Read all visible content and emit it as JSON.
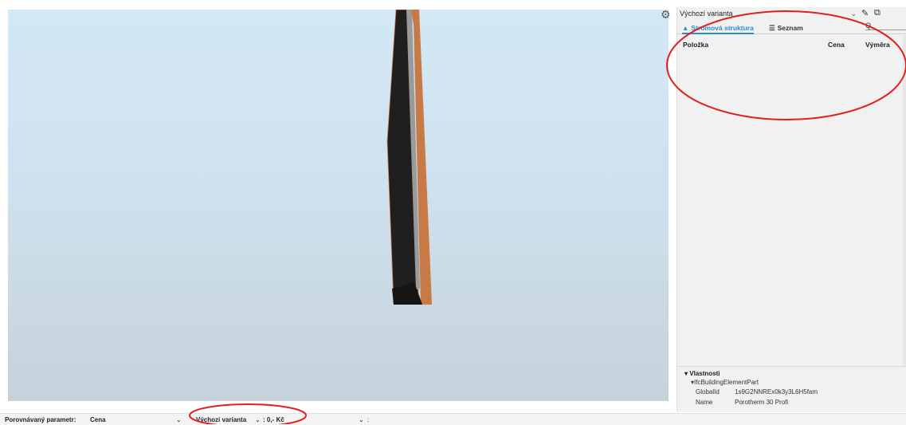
{
  "colors": {
    "accent": "#2a8ad4",
    "annotation": "#e02020",
    "wall_orange": "#c87a46",
    "wall_dark": "#1f1f1f",
    "wall_gray": "#9a9a9a",
    "sky_top": "#d3e8f7"
  },
  "icons": {
    "settings": "gear-icon",
    "edit": "pencil-icon",
    "copy": "copy-icon",
    "tree": "hierarchy-icon",
    "list": "list-icon",
    "search": "search-icon"
  },
  "panel": {
    "variant": "Výchozí varianta",
    "search_placeholder": "Q",
    "tabs": [
      {
        "label": "Stromová struktura",
        "active": true
      },
      {
        "label": "Seznam",
        "active": false
      }
    ],
    "columns": {
      "item": "Položka",
      "price": "Cena",
      "area": "Výměra"
    }
  },
  "properties": {
    "title": "Vlastnosti",
    "group": "IfcBuildingElementPart",
    "rows": [
      {
        "key": "GlobalId",
        "value": "1s9G2NNREx0k3y3L6H5fam"
      },
      {
        "key": "Name",
        "value": "Porotherm 30 Profi"
      }
    ]
  },
  "statusbar": {
    "param_label": "Porovnávaný parametr:",
    "param_value": "Cena",
    "variant": "Výchozí varianta",
    "price": ": 0,- Kč",
    "second_select": ":"
  }
}
